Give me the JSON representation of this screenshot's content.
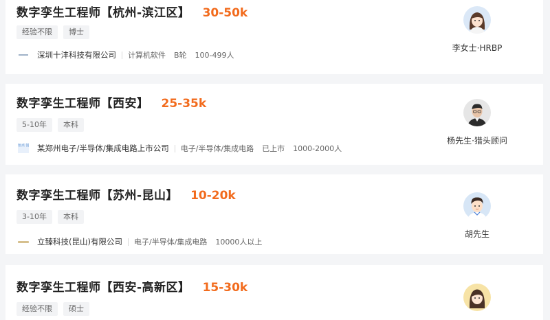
{
  "jobs": [
    {
      "title": "数字孪生工程师【杭州-滨江区】",
      "salary": "30-50k",
      "tags": [
        "经验不限",
        "博士"
      ],
      "company": "深圳十沣科技有限公司",
      "industry": "计算机软件",
      "stage": "B轮",
      "size": "100-499人",
      "recruiter": "李女士·HRBP",
      "avatar_icon": "female-avatar-icon",
      "avatar_bg": "#dbe8f7"
    },
    {
      "title": "数字孪生工程师【西安】",
      "salary": "25-35k",
      "tags": [
        "5-10年",
        "本科"
      ],
      "company": "某郑州电子/半导体/集成电路上市公司",
      "industry": "电子/半导体/集成电路",
      "stage": "已上市",
      "size": "1000-2000人",
      "company_logo_text": "氪点 猎头",
      "recruiter": "杨先生·猎头顾问",
      "avatar_icon": "male-photo-avatar-icon",
      "avatar_bg": "#e6e6e6"
    },
    {
      "title": "数字孪生工程师【苏州-昆山】",
      "salary": "10-20k",
      "tags": [
        "3-10年",
        "本科"
      ],
      "company": "立臻科技(昆山)有限公司",
      "industry": "电子/半导体/集成电路",
      "size": "10000人以上",
      "recruiter": "胡先生",
      "avatar_icon": "male-cartoon-avatar-icon",
      "avatar_bg": "#d7e6f6"
    },
    {
      "title": "数字孪生工程师【西安-高新区】",
      "salary": "15-30k",
      "tags": [
        "经验不限",
        "硕士"
      ],
      "avatar_icon": "female-cartoon-avatar-icon",
      "avatar_bg": "#f7e3a6"
    }
  ],
  "colors": {
    "salary": "#f26b1d",
    "page_bg": "#f4f5f7",
    "tag_bg": "#f2f3f5"
  }
}
